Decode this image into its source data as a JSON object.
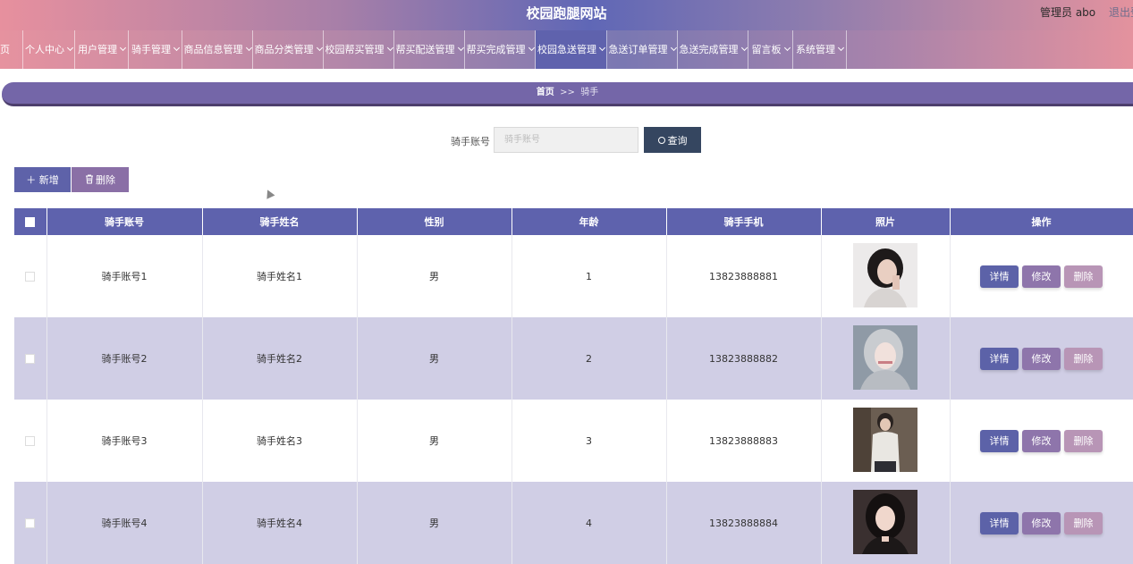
{
  "header": {
    "title": "校园跑腿网站",
    "admin": "管理员 abo",
    "logout": "退出登"
  },
  "nav": [
    {
      "label": "页",
      "dropdown": false
    },
    {
      "label": "个人中心",
      "dropdown": true
    },
    {
      "label": "用户管理",
      "dropdown": true
    },
    {
      "label": "骑手管理",
      "dropdown": true
    },
    {
      "label": "商品信息管理",
      "dropdown": true
    },
    {
      "label": "商品分类管理",
      "dropdown": true
    },
    {
      "label": "校园帮买管理",
      "dropdown": true
    },
    {
      "label": "帮买配送管理",
      "dropdown": true
    },
    {
      "label": "帮买完成管理",
      "dropdown": true
    },
    {
      "label": "校园急送管理",
      "dropdown": true
    },
    {
      "label": "急送订单管理",
      "dropdown": true
    },
    {
      "label": "急送完成管理",
      "dropdown": true
    },
    {
      "label": "留言板",
      "dropdown": true
    },
    {
      "label": "系统管理",
      "dropdown": true
    }
  ],
  "breadcrumb": {
    "home": "首页",
    "sep": ">>",
    "current": "骑手"
  },
  "search": {
    "label": "骑手账号",
    "placeholder": "骑手账号",
    "value": "",
    "button": "查询"
  },
  "toolbar": {
    "add": "新增",
    "delete": "删除"
  },
  "table": {
    "columns": [
      "骑手账号",
      "骑手姓名",
      "性别",
      "年龄",
      "骑手手机",
      "照片",
      "操作"
    ],
    "rows": [
      {
        "account": "骑手账号1",
        "name": "骑手姓名1",
        "gender": "男",
        "age": "1",
        "phone": "13823888881"
      },
      {
        "account": "骑手账号2",
        "name": "骑手姓名2",
        "gender": "男",
        "age": "2",
        "phone": "13823888882"
      },
      {
        "account": "骑手账号3",
        "name": "骑手姓名3",
        "gender": "男",
        "age": "3",
        "phone": "13823888883"
      },
      {
        "account": "骑手账号4",
        "name": "骑手姓名4",
        "gender": "男",
        "age": "4",
        "phone": "13823888884"
      }
    ],
    "actions": {
      "detail": "详情",
      "edit": "修改",
      "remove": "删除"
    }
  },
  "colors": {
    "primary": "#5e62ad",
    "accent": "#8e75ab",
    "danger": "#b895b6",
    "row_alt": "#d0cee5"
  }
}
